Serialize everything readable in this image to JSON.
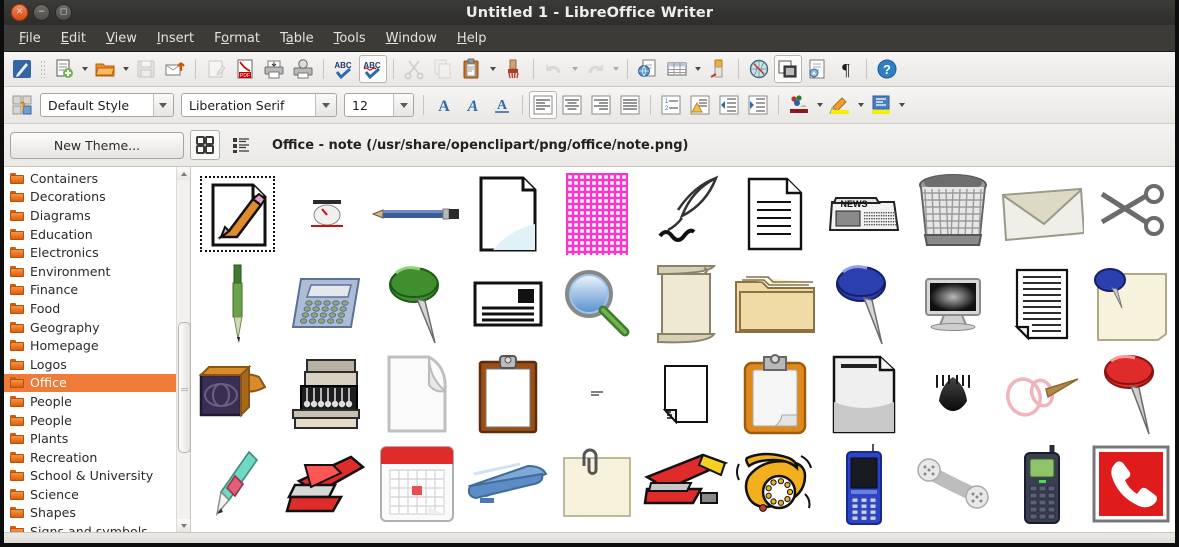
{
  "window": {
    "title": "Untitled 1 - LibreOffice Writer",
    "buttons": {
      "close": "close-button",
      "minimize": "minimize-button",
      "maximize": "maximize-button"
    }
  },
  "menubar": {
    "items": [
      {
        "label": "File",
        "accel": "F"
      },
      {
        "label": "Edit",
        "accel": "E"
      },
      {
        "label": "View",
        "accel": "V"
      },
      {
        "label": "Insert",
        "accel": "I"
      },
      {
        "label": "Format",
        "accel": "o"
      },
      {
        "label": "Table",
        "accel": "a"
      },
      {
        "label": "Tools",
        "accel": "T"
      },
      {
        "label": "Window",
        "accel": "W"
      },
      {
        "label": "Help",
        "accel": "H"
      }
    ]
  },
  "standard_toolbar": {
    "items": [
      {
        "name": "load-url-icon",
        "enabled": true
      },
      {
        "name": "new-document-icon",
        "enabled": true,
        "dropdown": true
      },
      {
        "name": "open-icon",
        "enabled": true,
        "dropdown": true
      },
      {
        "name": "save-icon",
        "enabled": false
      },
      {
        "name": "email-document-icon",
        "enabled": true
      },
      {
        "name": "edit-mode-icon",
        "enabled": false
      },
      {
        "name": "export-pdf-icon",
        "enabled": true
      },
      {
        "name": "print-icon",
        "enabled": true
      },
      {
        "name": "print-preview-icon",
        "enabled": true
      },
      {
        "name": "spelling-icon",
        "enabled": true
      },
      {
        "name": "autospellcheck-icon",
        "enabled": true,
        "active": true
      },
      {
        "name": "cut-icon",
        "enabled": false
      },
      {
        "name": "copy-icon",
        "enabled": false
      },
      {
        "name": "paste-icon",
        "enabled": true,
        "dropdown": true
      },
      {
        "name": "clone-formatting-icon",
        "enabled": true
      },
      {
        "name": "undo-icon",
        "enabled": false,
        "dropdown": true
      },
      {
        "name": "redo-icon",
        "enabled": false,
        "dropdown": true
      },
      {
        "name": "hyperlink-icon",
        "enabled": true
      },
      {
        "name": "insert-table-icon",
        "enabled": true,
        "dropdown": true
      },
      {
        "name": "show-draw-functions-icon",
        "enabled": true
      },
      {
        "name": "find-replace-icon",
        "enabled": true
      },
      {
        "name": "gallery-icon",
        "enabled": true,
        "active": true
      },
      {
        "name": "navigator-icon",
        "enabled": true
      },
      {
        "name": "formatting-marks-icon",
        "enabled": true
      },
      {
        "name": "help-icon",
        "enabled": true
      }
    ]
  },
  "formatting_toolbar": {
    "styles_icon": "paragraph-style-icon",
    "paragraph_style": {
      "value": "Default Style"
    },
    "font_name": {
      "value": "Liberation Serif"
    },
    "font_size": {
      "value": "12"
    },
    "buttons": [
      {
        "name": "bold-button",
        "label": "A"
      },
      {
        "name": "italic-button",
        "label": "A"
      },
      {
        "name": "underline-button",
        "label": "A"
      },
      {
        "name": "align-left-button",
        "active": true
      },
      {
        "name": "align-center-button"
      },
      {
        "name": "align-right-button"
      },
      {
        "name": "justify-button"
      },
      {
        "name": "ordered-list-button"
      },
      {
        "name": "unordered-list-button"
      },
      {
        "name": "decrease-indent-button"
      },
      {
        "name": "increase-indent-button"
      },
      {
        "name": "font-color-button",
        "dropdown": true
      },
      {
        "name": "highlighting-color-button",
        "dropdown": true
      },
      {
        "name": "background-color-button",
        "dropdown": true
      }
    ]
  },
  "gallery": {
    "new_theme_label": "New Theme...",
    "view_icon_label": "icon-view-button",
    "view_list_label": "list-view-button",
    "path": "Office - note (/usr/share/openclipart/png/office/note.png)",
    "themes": [
      {
        "label": "Containers",
        "selected": false
      },
      {
        "label": "Decorations",
        "selected": false
      },
      {
        "label": "Diagrams",
        "selected": false
      },
      {
        "label": "Education",
        "selected": false
      },
      {
        "label": "Electronics",
        "selected": false
      },
      {
        "label": "Environment",
        "selected": false
      },
      {
        "label": "Finance",
        "selected": false
      },
      {
        "label": "Food",
        "selected": false
      },
      {
        "label": "Geography",
        "selected": false
      },
      {
        "label": "Homepage",
        "selected": false
      },
      {
        "label": "Logos",
        "selected": false
      },
      {
        "label": "Office",
        "selected": true
      },
      {
        "label": "People",
        "selected": false
      },
      {
        "label": "People",
        "selected": false
      },
      {
        "label": "Plants",
        "selected": false
      },
      {
        "label": "Recreation",
        "selected": false
      },
      {
        "label": "School & University",
        "selected": false
      },
      {
        "label": "Science",
        "selected": false
      },
      {
        "label": "Shapes",
        "selected": false
      },
      {
        "label": "Signs and symbols",
        "selected": false
      }
    ],
    "items": [
      {
        "name": "note-thumbnail",
        "selected": true
      },
      {
        "name": "gauge-meter-thumbnail",
        "selected": false
      },
      {
        "name": "blue-pencil-thumbnail",
        "selected": false
      },
      {
        "name": "blank-page-thumbnail",
        "selected": false
      },
      {
        "name": "pink-grid-paper-thumbnail",
        "selected": false
      },
      {
        "name": "quill-pen-thumbnail",
        "selected": false
      },
      {
        "name": "text-document-thumbnail",
        "selected": false
      },
      {
        "name": "newspaper-thumbnail",
        "selected": false
      },
      {
        "name": "wastebasket-thumbnail",
        "selected": false
      },
      {
        "name": "envelope-thumbnail",
        "selected": false
      },
      {
        "name": "scissors-thumbnail",
        "selected": false
      },
      {
        "name": "green-pen-thumbnail",
        "selected": false
      },
      {
        "name": "calculator-thumbnail",
        "selected": false
      },
      {
        "name": "green-pushpin-thumbnail",
        "selected": false
      },
      {
        "name": "mail-letter-thumbnail",
        "selected": false
      },
      {
        "name": "magnifying-glass-thumbnail",
        "selected": false
      },
      {
        "name": "scroll-parchment-thumbnail",
        "selected": false
      },
      {
        "name": "folder-thumbnail",
        "selected": false
      },
      {
        "name": "blue-pushpin-thumbnail",
        "selected": false
      },
      {
        "name": "monitor-thumbnail",
        "selected": false
      },
      {
        "name": "lined-document-thumbnail",
        "selected": false
      },
      {
        "name": "pinned-note-thumbnail",
        "selected": false
      },
      {
        "name": "rubber-stamp-thumbnail",
        "selected": false
      },
      {
        "name": "cash-register-thumbnail",
        "selected": false
      },
      {
        "name": "curled-paper-thumbnail",
        "selected": false
      },
      {
        "name": "clipboard-thumbnail",
        "selected": false
      },
      {
        "name": "small-dash-thumbnail",
        "selected": false
      },
      {
        "name": "folded-page-thumbnail",
        "selected": false
      },
      {
        "name": "orange-clipboard-thumbnail",
        "selected": false
      },
      {
        "name": "grey-document-thumbnail",
        "selected": false
      },
      {
        "name": "ink-blot-thumbnail",
        "selected": false
      },
      {
        "name": "pink-pushpin-outline-thumbnail",
        "selected": false
      },
      {
        "name": "red-pushpin-thumbnail",
        "selected": false
      },
      {
        "name": "mechanical-pencil-thumbnail",
        "selected": false
      },
      {
        "name": "red-stapler-thumbnail",
        "selected": false
      },
      {
        "name": "calendar-thumbnail",
        "selected": false
      },
      {
        "name": "blue-stapler-thumbnail",
        "selected": false
      },
      {
        "name": "paperclip-note-thumbnail",
        "selected": false
      },
      {
        "name": "red-stapler-open-thumbnail",
        "selected": false
      },
      {
        "name": "rotary-phone-thumbnail",
        "selected": false
      },
      {
        "name": "blue-mobile-phone-thumbnail",
        "selected": false
      },
      {
        "name": "telephone-handset-thumbnail",
        "selected": false
      },
      {
        "name": "cell-phone-thumbnail",
        "selected": false
      },
      {
        "name": "red-phone-sign-thumbnail",
        "selected": false
      }
    ]
  },
  "colors": {
    "selection": "#ee7b38",
    "titlebar": "#32312e",
    "close_button": "#da4b12"
  }
}
